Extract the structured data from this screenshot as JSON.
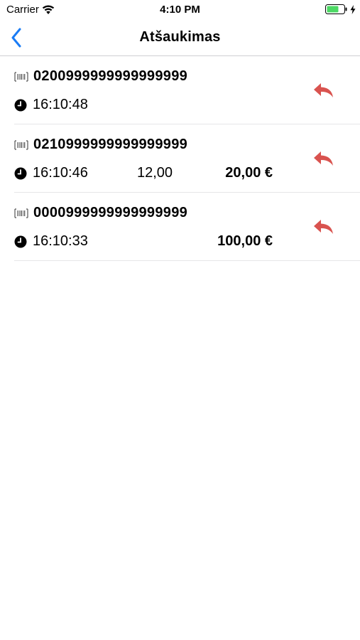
{
  "status_bar": {
    "carrier": "Carrier",
    "time": "4:10 PM",
    "icons": [
      "wifi-icon",
      "battery-icon",
      "charging-bolt-icon"
    ],
    "battery_color": "#4cd964"
  },
  "nav": {
    "title": "Atšaukimas",
    "back_icon": "chevron-left-icon",
    "accent_color": "#1a7cf5"
  },
  "transactions": [
    {
      "code": "0200999999999999999",
      "time": "16:10:48",
      "quantity": "",
      "amount": ""
    },
    {
      "code": "0210999999999999999",
      "time": "16:10:46",
      "quantity": "12,00",
      "amount": "20,00 €"
    },
    {
      "code": "0000999999999999999",
      "time": "16:10:33",
      "quantity": "",
      "amount": "100,00 €"
    }
  ],
  "undo_icon": "undo-reply-icon",
  "undo_color": "#d9534f"
}
